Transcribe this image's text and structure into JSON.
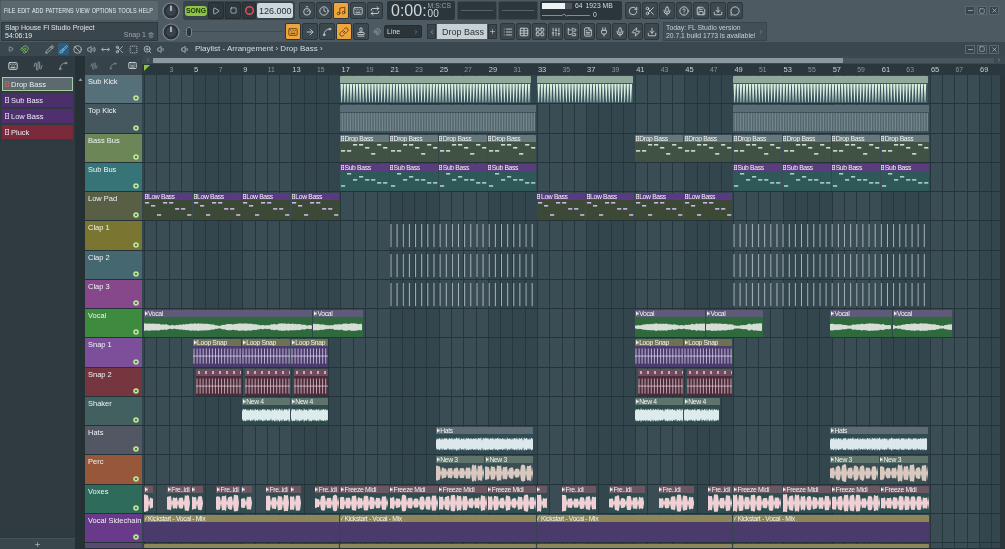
{
  "menu": [
    "FILE",
    "EDIT",
    "ADD",
    "PATTERNS",
    "VIEW",
    "OPTIONS",
    "TOOLS",
    "HELP"
  ],
  "transport": {
    "song_mode": true,
    "song_label": "SONG",
    "tempo": "126.000",
    "time": "0:00:",
    "time_fraction": "00",
    "time_format": "M:S:CS"
  },
  "toolbar_top": [
    {
      "on": false
    },
    {
      "on": false
    },
    {
      "on": true
    },
    {
      "on": false
    },
    {
      "on": false
    }
  ],
  "monitor": {
    "level": 0.78,
    "voices": "64",
    "memory": "1923 MB",
    "reading": "0"
  },
  "project": {
    "title": "Slap House Fl Studio Project",
    "time": "54:06:19",
    "snap": "Snap 1"
  },
  "pitch_slider": {
    "level": 0.03
  },
  "toolbar_bottom": [
    {
      "on": true
    },
    {
      "on": false
    },
    {
      "on": false
    },
    {
      "on": true
    },
    {
      "on": false
    }
  ],
  "snap_mode": "Line",
  "pattern_selector": "Drop Bass",
  "news": {
    "line_1": "Today: FL Studio version",
    "line_2": "20.7.1 build 1773 is available!"
  },
  "playlist": {
    "title": "Playlist - Arrangement › Drop Bass ›",
    "snap_on": true,
    "tools": [
      {
        "selected": false
      },
      {
        "selected": true
      },
      {
        "selected": false
      },
      {
        "selected": false
      },
      {
        "selected": false
      },
      {
        "selected": false
      },
      {
        "selected": false
      },
      {
        "selected": false
      },
      {
        "selected": false
      }
    ]
  },
  "patterns": [
    {
      "name": "Drop Bass",
      "color": "#5c6a70",
      "selected": true
    },
    {
      "name": "Sub Bass",
      "color": "#4b2f6b",
      "selected": false
    },
    {
      "name": "Low Bass",
      "color": "#4f2f6e",
      "selected": false
    },
    {
      "name": "Pluck",
      "color": "#7b2a3c",
      "selected": false
    }
  ],
  "ruler": [
    "3",
    "5",
    "7",
    "9",
    "11",
    "13",
    "15",
    "17",
    "19",
    "21",
    "23",
    "25",
    "27",
    "29",
    "31",
    "33",
    "35",
    "37",
    "39",
    "41",
    "43",
    "45",
    "47",
    "49",
    "51",
    "53",
    "55",
    "57",
    "59",
    "61",
    "63",
    "65",
    "67",
    "69"
  ],
  "tracks": [
    {
      "name": "Sub Kick",
      "color": "#56707a",
      "enabled": true,
      "clips": [
        {
          "kind": "audio"
        },
        {
          "kind": "audio"
        },
        {
          "kind": "audio"
        }
      ]
    },
    {
      "name": "Top Kick",
      "color": "#46585f",
      "enabled": true,
      "clips": [
        {
          "kind": "audio"
        },
        {
          "kind": "audio"
        }
      ]
    },
    {
      "name": "Bass Bus",
      "color": "#6c8657",
      "enabled": true,
      "clips": [
        {
          "kind": "pattern",
          "label": "Drop Bass"
        },
        {
          "kind": "pattern",
          "label": "Drop Bass"
        },
        {
          "kind": "pattern",
          "label": "Drop Bass"
        },
        {
          "kind": "pattern",
          "label": "Drop Bass"
        },
        {
          "kind": "pattern",
          "label": "Drop Bass"
        },
        {
          "kind": "pattern",
          "label": "Drop Bass"
        },
        {
          "kind": "pattern",
          "label": "Drop Bass"
        },
        {
          "kind": "pattern",
          "label": "Drop Bass"
        },
        {
          "kind": "pattern",
          "label": "Drop Bass"
        },
        {
          "kind": "pattern",
          "label": "Drop Bass"
        }
      ]
    },
    {
      "name": "Sub Bus",
      "color": "#367478",
      "enabled": true,
      "clips": [
        {
          "kind": "pattern",
          "label": "Sub Bass"
        },
        {
          "kind": "pattern",
          "label": "Sub Bass"
        },
        {
          "kind": "pattern",
          "label": "Sub Bass"
        },
        {
          "kind": "pattern",
          "label": "Sub Bass"
        },
        {
          "kind": "pattern",
          "label": "Sub Bass"
        },
        {
          "kind": "pattern",
          "label": "Sub Bass"
        },
        {
          "kind": "pattern",
          "label": "Sub Bass"
        },
        {
          "kind": "pattern",
          "label": "Sub Bass"
        }
      ]
    },
    {
      "name": "Low Pad",
      "color": "#585f45",
      "enabled": true,
      "clips": [
        {
          "kind": "pattern",
          "label": "Low Bass"
        },
        {
          "kind": "pattern",
          "label": "Low Bass"
        },
        {
          "kind": "pattern",
          "label": "Low Bass"
        },
        {
          "kind": "pattern",
          "label": "Low Bass"
        },
        {
          "kind": "pattern",
          "label": "Low Bass"
        },
        {
          "kind": "pattern",
          "label": "Low Bass"
        },
        {
          "kind": "pattern",
          "label": "Low Bass"
        },
        {
          "kind": "pattern",
          "label": "Low Bass"
        }
      ]
    },
    {
      "name": "Clap 1",
      "color": "#7a7530",
      "enabled": true,
      "clips": [
        {
          "kind": "audio"
        },
        {
          "kind": "audio"
        }
      ]
    },
    {
      "name": "Clap 2",
      "color": "#456870",
      "enabled": true,
      "clips": [
        {
          "kind": "audio"
        },
        {
          "kind": "audio"
        }
      ]
    },
    {
      "name": "Clap 3",
      "color": "#86488a",
      "enabled": true,
      "clips": [
        {
          "kind": "audio"
        },
        {
          "kind": "audio"
        }
      ]
    },
    {
      "name": "Vocal",
      "color": "#3e8a3e",
      "enabled": true,
      "clips": [
        {
          "kind": "audio",
          "label": "Vocal"
        },
        {
          "kind": "audio",
          "label": "Vocal"
        },
        {
          "kind": "audio",
          "label": "Vocal"
        },
        {
          "kind": "audio",
          "label": "Vocal"
        },
        {
          "kind": "audio",
          "label": "Vocal"
        },
        {
          "kind": "audio",
          "label": "Vocal"
        }
      ]
    },
    {
      "name": "Snap 1",
      "color": "#7d4f9a",
      "enabled": true,
      "clips": [
        {
          "kind": "audio",
          "label": "Loop Snap"
        },
        {
          "kind": "audio",
          "label": "Loop Snap"
        },
        {
          "kind": "audio",
          "label": "Loop Snap"
        },
        {
          "kind": "audio",
          "label": "Loop Snap"
        },
        {
          "kind": "audio",
          "label": "Loop Snap"
        }
      ]
    },
    {
      "name": "Snap 2",
      "color": "#76363f",
      "enabled": true,
      "clips": [
        {
          "kind": "audio"
        },
        {
          "kind": "audio"
        },
        {
          "kind": "audio"
        },
        {
          "kind": "audio"
        },
        {
          "kind": "audio"
        }
      ]
    },
    {
      "name": "Shaker",
      "color": "#41605f",
      "enabled": true,
      "clips": [
        {
          "kind": "audio",
          "label": "New 4"
        },
        {
          "kind": "audio",
          "label": "New 4"
        },
        {
          "kind": "audio",
          "label": "New 4"
        },
        {
          "kind": "audio",
          "label": "New 4"
        }
      ]
    },
    {
      "name": "Hats",
      "color": "#535764",
      "enabled": true,
      "clips": [
        {
          "kind": "audio",
          "label": "Hats"
        },
        {
          "kind": "audio",
          "label": "Hats"
        }
      ]
    },
    {
      "name": "Perc",
      "color": "#96573a",
      "enabled": true,
      "clips": [
        {
          "kind": "audio",
          "label": "New 3"
        },
        {
          "kind": "audio",
          "label": "New 3"
        },
        {
          "kind": "audio",
          "label": "New 3"
        },
        {
          "kind": "audio",
          "label": "New 3"
        }
      ]
    },
    {
      "name": "Voxes",
      "color": "#2f6b5a",
      "enabled": true,
      "clips": [
        {
          "kind": "audio"
        },
        {
          "kind": "audio",
          "label": "Fre..idi"
        },
        {
          "kind": "audio"
        },
        {
          "kind": "audio",
          "label": "Fre..idi"
        },
        {
          "kind": "audio"
        },
        {
          "kind": "audio",
          "label": "Fre..idi"
        },
        {
          "kind": "audio"
        },
        {
          "kind": "audio",
          "label": "Fre..idi"
        },
        {
          "kind": "audio",
          "label": "Freeze Midi"
        },
        {
          "kind": "audio",
          "label": "Freeze Midi"
        },
        {
          "kind": "audio",
          "label": "Freeze Midi"
        },
        {
          "kind": "audio",
          "label": "Freeze Midi"
        },
        {
          "kind": "audio"
        },
        {
          "kind": "audio",
          "label": "Fre..idi"
        },
        {
          "kind": "audio",
          "label": "Fre..idi"
        },
        {
          "kind": "audio",
          "label": "Fre..idi"
        },
        {
          "kind": "audio",
          "label": "Fre..idi"
        },
        {
          "kind": "audio",
          "label": "Freeze Midi"
        },
        {
          "kind": "audio",
          "label": "Freeze Midi"
        },
        {
          "kind": "audio",
          "label": "Freeze Midi"
        },
        {
          "kind": "audio",
          "label": "Freeze Midi"
        }
      ]
    },
    {
      "name": "Vocal Sidechain",
      "color": "#6a3a8a",
      "enabled": true,
      "clips": [
        {
          "kind": "automation",
          "label": "Kickstart - Vocal - Mix"
        },
        {
          "kind": "automation",
          "label": "Kickstart - Vocal - Mix"
        },
        {
          "kind": "automation",
          "label": "Kickstart - Vocal - Mix"
        },
        {
          "kind": "automation",
          "label": "Kickstart - Vocal - Mix"
        }
      ]
    },
    {
      "color": "#5a4a6e",
      "clips": [
        {
          "kind": "automation"
        },
        {
          "kind": "automation"
        },
        {
          "kind": "automation"
        },
        {
          "kind": "automation"
        }
      ]
    }
  ]
}
